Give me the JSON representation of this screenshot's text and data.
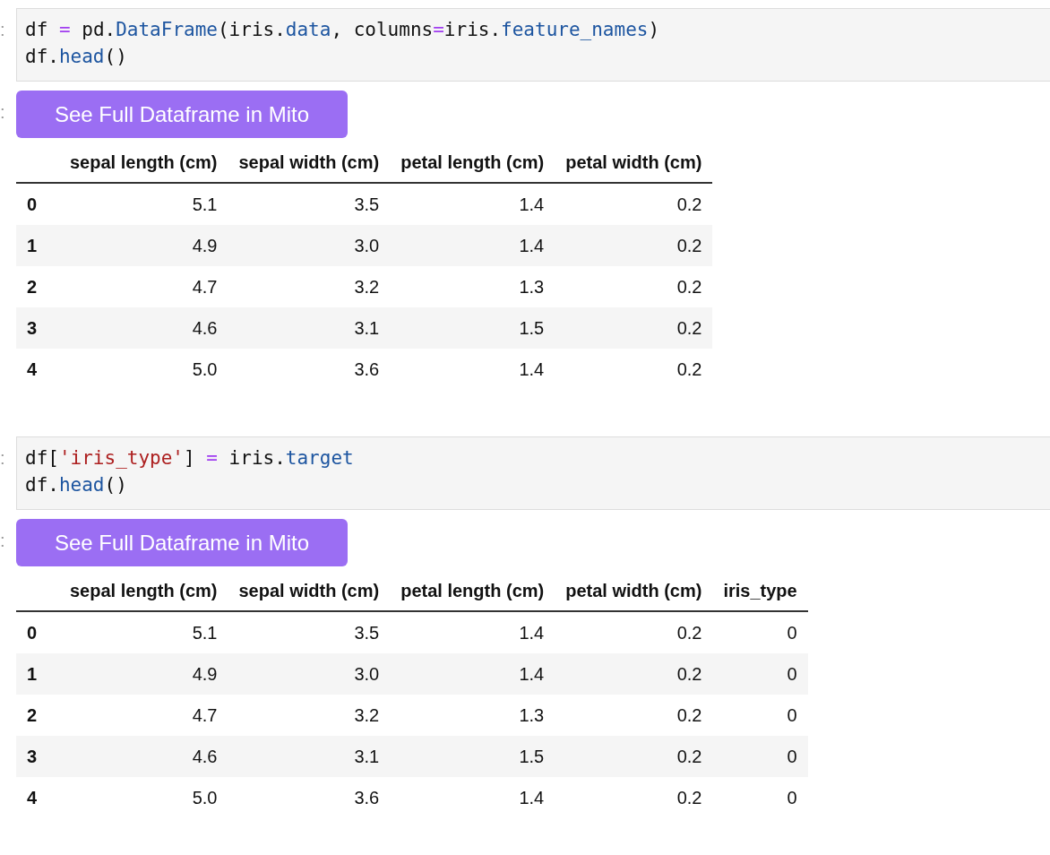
{
  "cells": [
    {
      "prompt": ":",
      "code_lines": [
        [
          {
            "text": "df ",
            "kind": "plain"
          },
          {
            "text": "=",
            "kind": "op"
          },
          {
            "text": " pd.",
            "kind": "plain"
          },
          {
            "text": "DataFrame",
            "kind": "attr"
          },
          {
            "text": "(iris.",
            "kind": "plain"
          },
          {
            "text": "data",
            "kind": "attr"
          },
          {
            "text": ", columns",
            "kind": "plain"
          },
          {
            "text": "=",
            "kind": "op"
          },
          {
            "text": "iris.",
            "kind": "plain"
          },
          {
            "text": "feature_names",
            "kind": "attr"
          },
          {
            "text": ")",
            "kind": "plain"
          }
        ],
        [
          {
            "text": "df.",
            "kind": "plain"
          },
          {
            "text": "head",
            "kind": "attr"
          },
          {
            "text": "()",
            "kind": "plain"
          }
        ]
      ],
      "output": {
        "prompt": ":",
        "button": "See Full Dataframe in Mito",
        "table": {
          "columns": [
            "sepal length (cm)",
            "sepal width (cm)",
            "petal length (cm)",
            "petal width (cm)"
          ],
          "rows": [
            {
              "index": "0",
              "values": [
                "5.1",
                "3.5",
                "1.4",
                "0.2"
              ]
            },
            {
              "index": "1",
              "values": [
                "4.9",
                "3.0",
                "1.4",
                "0.2"
              ]
            },
            {
              "index": "2",
              "values": [
                "4.7",
                "3.2",
                "1.3",
                "0.2"
              ]
            },
            {
              "index": "3",
              "values": [
                "4.6",
                "3.1",
                "1.5",
                "0.2"
              ]
            },
            {
              "index": "4",
              "values": [
                "5.0",
                "3.6",
                "1.4",
                "0.2"
              ]
            }
          ]
        }
      }
    },
    {
      "prompt": ":",
      "code_lines": [
        [
          {
            "text": "df[",
            "kind": "plain"
          },
          {
            "text": "'iris_type'",
            "kind": "string"
          },
          {
            "text": "] ",
            "kind": "plain"
          },
          {
            "text": "=",
            "kind": "op"
          },
          {
            "text": " iris.",
            "kind": "plain"
          },
          {
            "text": "target",
            "kind": "attr"
          }
        ],
        [
          {
            "text": "df.",
            "kind": "plain"
          },
          {
            "text": "head",
            "kind": "attr"
          },
          {
            "text": "()",
            "kind": "plain"
          }
        ]
      ],
      "output": {
        "prompt": ":",
        "button": "See Full Dataframe in Mito",
        "table": {
          "columns": [
            "sepal length (cm)",
            "sepal width (cm)",
            "petal length (cm)",
            "petal width (cm)",
            "iris_type"
          ],
          "rows": [
            {
              "index": "0",
              "values": [
                "5.1",
                "3.5",
                "1.4",
                "0.2",
                "0"
              ]
            },
            {
              "index": "1",
              "values": [
                "4.9",
                "3.0",
                "1.4",
                "0.2",
                "0"
              ]
            },
            {
              "index": "2",
              "values": [
                "4.7",
                "3.2",
                "1.3",
                "0.2",
                "0"
              ]
            },
            {
              "index": "3",
              "values": [
                "4.6",
                "3.1",
                "1.5",
                "0.2",
                "0"
              ]
            },
            {
              "index": "4",
              "values": [
                "5.0",
                "3.6",
                "1.4",
                "0.2",
                "0"
              ]
            }
          ]
        }
      }
    }
  ]
}
